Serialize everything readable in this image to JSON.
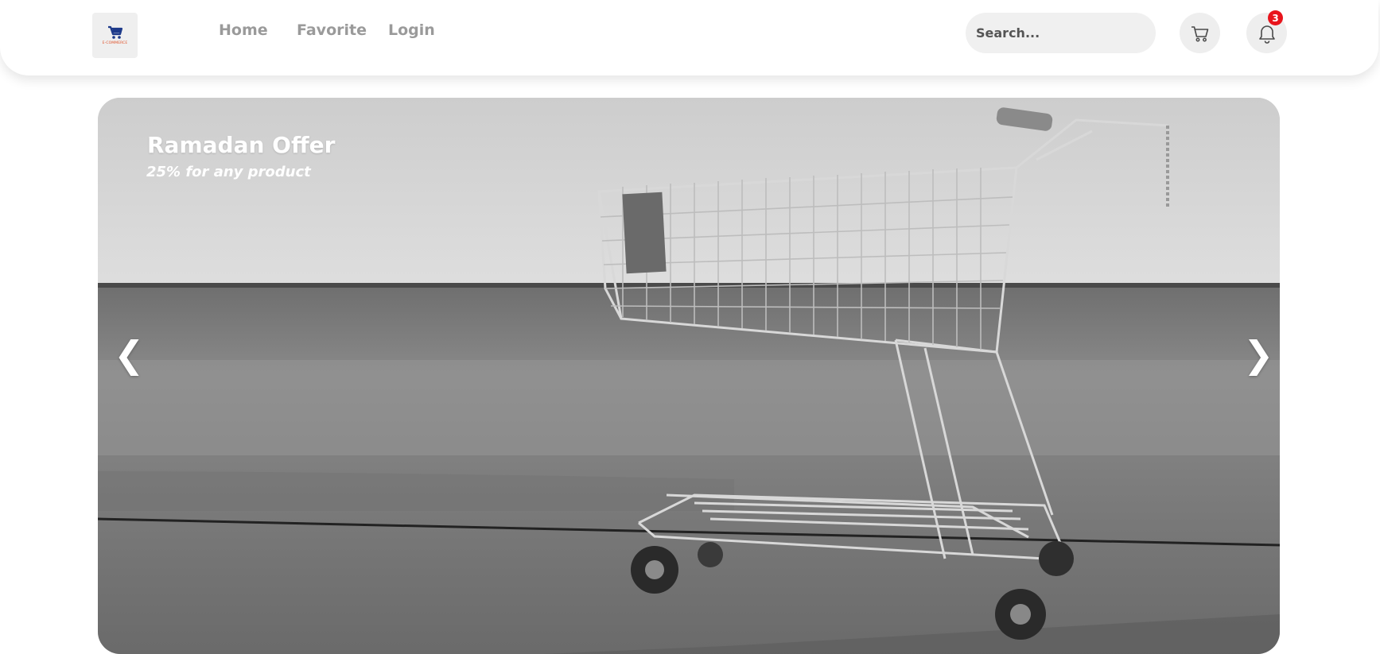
{
  "navbar": {
    "logo": {
      "icon": "cart-icon",
      "text": "E-COMMERCE",
      "text_color": "#e0522a",
      "icon_color": "#1d3a8a"
    },
    "links": [
      {
        "label": "Home"
      },
      {
        "label": "Favorite"
      },
      {
        "label": "Login"
      }
    ],
    "search": {
      "placeholder": "Search...",
      "value": ""
    },
    "cart": {
      "icon": "cart-icon"
    },
    "notifications": {
      "icon": "bell-icon",
      "count": "3",
      "badge_color": "#e8141c"
    }
  },
  "hero": {
    "title": "Ramadan Offer",
    "subtitle": "25% for any product",
    "prev_label": "❮",
    "next_label": "❯",
    "image": "shopping-cart-photo"
  }
}
